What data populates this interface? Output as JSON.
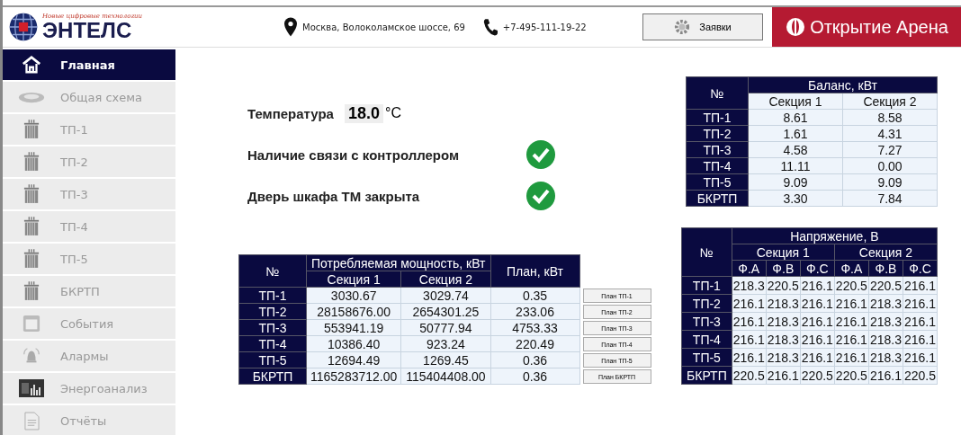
{
  "header": {
    "logo": {
      "tagline": "Новые цифровые технологии",
      "name": "ЭНТЕЛС"
    },
    "address": "Москва, Волоколамское шоссе, 69",
    "phone": "+7-495-111-19-22",
    "requests_button": "Заявки",
    "brand": "Открытие Арена"
  },
  "sidebar": {
    "items": [
      {
        "label": "Главная",
        "kind": "home",
        "selected": true
      },
      {
        "label": "Общая схема",
        "kind": "scheme",
        "selected": false
      },
      {
        "label": "ТП-1",
        "kind": "substation",
        "selected": false
      },
      {
        "label": "ТП-2",
        "kind": "substation",
        "selected": false
      },
      {
        "label": "ТП-3",
        "kind": "substation",
        "selected": false
      },
      {
        "label": "ТП-4",
        "kind": "substation",
        "selected": false
      },
      {
        "label": "ТП-5",
        "kind": "substation",
        "selected": false
      },
      {
        "label": "БКРТП",
        "kind": "substation",
        "selected": false
      },
      {
        "label": "События",
        "kind": "events",
        "selected": false
      },
      {
        "label": "Алармы",
        "kind": "alarms",
        "selected": false
      },
      {
        "label": "Энергоанализ",
        "kind": "analysis",
        "selected": false
      },
      {
        "label": "Отчёты",
        "kind": "reports",
        "selected": false
      }
    ]
  },
  "temperature": {
    "label": "Температура",
    "value": "18.0",
    "unit": "°C"
  },
  "statuses": [
    {
      "label": "Наличие связи с контроллером",
      "ok": true
    },
    {
      "label": "Дверь шкафа ТМ закрыта",
      "ok": true
    }
  ],
  "balance_table": {
    "number_header": "№",
    "title": "Баланс, кВт",
    "sections": [
      "Секция 1",
      "Секция 2"
    ],
    "rows": [
      {
        "name": "ТП-1",
        "values": [
          "8.61",
          "8.58"
        ]
      },
      {
        "name": "ТП-2",
        "values": [
          "1.61",
          "4.31"
        ]
      },
      {
        "name": "ТП-3",
        "values": [
          "4.58",
          "7.27"
        ]
      },
      {
        "name": "ТП-4",
        "values": [
          "11.11",
          "0.00"
        ]
      },
      {
        "name": "ТП-5",
        "values": [
          "9.09",
          "9.09"
        ]
      },
      {
        "name": "БКРТП",
        "values": [
          "3.30",
          "7.84"
        ]
      }
    ]
  },
  "power_table": {
    "number_header": "№",
    "title": "Потребляемая мощность, кВт",
    "sections": [
      "Секция 1",
      "Секция 2"
    ],
    "plan_header": "План, кВт",
    "rows": [
      {
        "name": "ТП-1",
        "values": [
          "3030.67",
          "3029.74"
        ],
        "plan": "0.35",
        "button": "План ТП-1"
      },
      {
        "name": "ТП-2",
        "values": [
          "28158676.00",
          "2654301.25"
        ],
        "plan": "233.06",
        "button": "План ТП-2"
      },
      {
        "name": "ТП-3",
        "values": [
          "553941.19",
          "50777.94"
        ],
        "plan": "4753.33",
        "button": "План ТП-3"
      },
      {
        "name": "ТП-4",
        "values": [
          "10386.40",
          "923.24"
        ],
        "plan": "220.49",
        "button": "План ТП-4"
      },
      {
        "name": "ТП-5",
        "values": [
          "12694.49",
          "1269.45"
        ],
        "plan": "0.36",
        "button": "План ТП-5"
      },
      {
        "name": "БКРТП",
        "values": [
          "1165283712.00",
          "115404408.00"
        ],
        "plan": "0.36",
        "button": "План БКРТП"
      }
    ]
  },
  "voltage_table": {
    "number_header": "№",
    "title": "Напряжение, В",
    "sections": [
      "Секция 1",
      "Секция 2"
    ],
    "phases": [
      "Ф.А",
      "Ф.В",
      "Ф.С",
      "Ф.А",
      "Ф.В",
      "Ф.С"
    ],
    "rows": [
      {
        "name": "ТП-1",
        "values": [
          "218.3",
          "220.5",
          "216.1",
          "220.5",
          "220.5",
          "216.1"
        ]
      },
      {
        "name": "ТП-2",
        "values": [
          "216.1",
          "218.3",
          "216.1",
          "216.1",
          "218.3",
          "216.1"
        ]
      },
      {
        "name": "ТП-3",
        "values": [
          "216.1",
          "218.3",
          "216.1",
          "216.1",
          "218.3",
          "216.1"
        ]
      },
      {
        "name": "ТП-4",
        "values": [
          "216.1",
          "218.3",
          "216.1",
          "216.1",
          "218.3",
          "216.1"
        ]
      },
      {
        "name": "ТП-5",
        "values": [
          "216.1",
          "218.3",
          "216.1",
          "216.1",
          "218.3",
          "216.1"
        ]
      },
      {
        "name": "БКРТП",
        "values": [
          "220.5",
          "216.1",
          "220.5",
          "220.5",
          "216.1",
          "220.5"
        ]
      }
    ]
  }
}
